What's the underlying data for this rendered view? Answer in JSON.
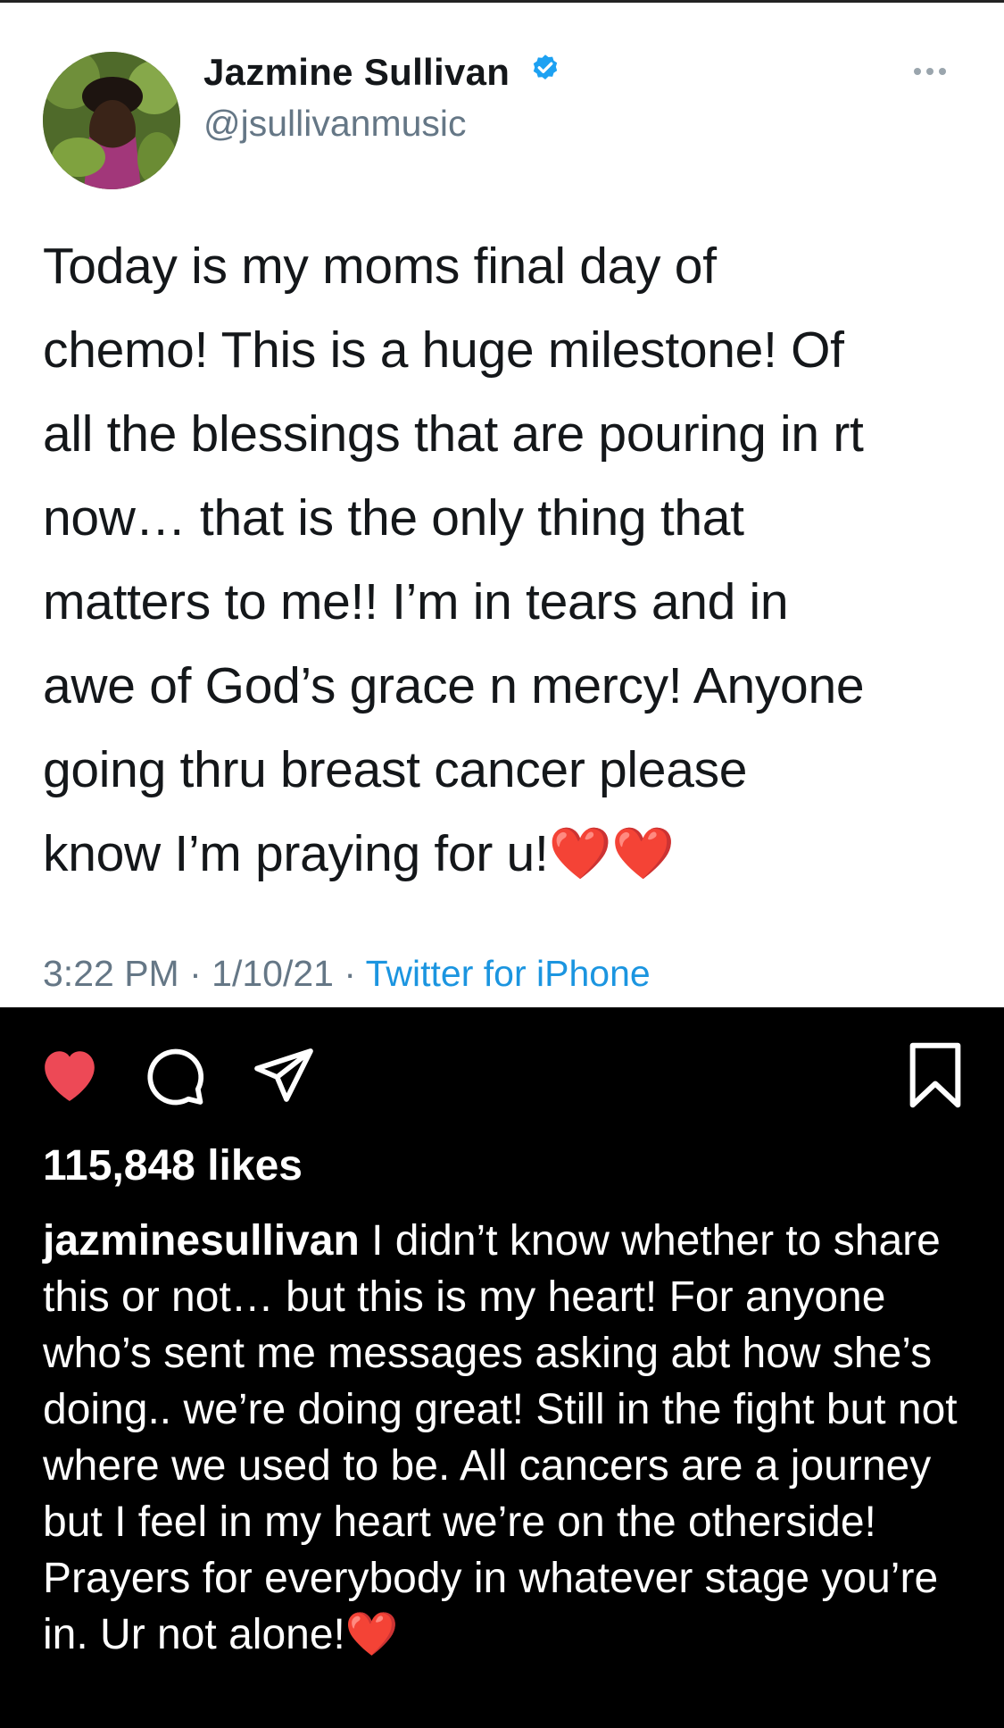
{
  "tweet": {
    "display_name": "Jazmine Sullivan",
    "handle": "@jsullivanmusic",
    "text": "Today is my moms final day of\nchemo! This is a huge milestone! Of\nall the blessings that are pouring in rt\nnow… that is the only thing that\nmatters to me!! I’m in tears and in\nawe of God’s grace n mercy! Anyone\ngoing thru breast cancer please\nknow I’m praying for u!❤️❤️",
    "time": "3:22 PM",
    "date": "1/10/21",
    "separator": " · ",
    "source": "Twitter for iPhone"
  },
  "instagram": {
    "likes": "115,848 likes",
    "username": "jazminesullivan",
    "caption": " I didn’t know whether to share this or not… but this is my heart! For anyone who’s sent me messages asking abt how she’s doing.. we’re doing great! Still in the fight but not where we used to be. All cancers are a journey but I feel in my heart we’re on the otherside! Prayers for everybody in whatever stage you’re in. Ur not alone!❤️"
  },
  "colors": {
    "like_heart": "#ed4956",
    "verified_badge": "#1da1f2",
    "link": "#1b95e0"
  }
}
